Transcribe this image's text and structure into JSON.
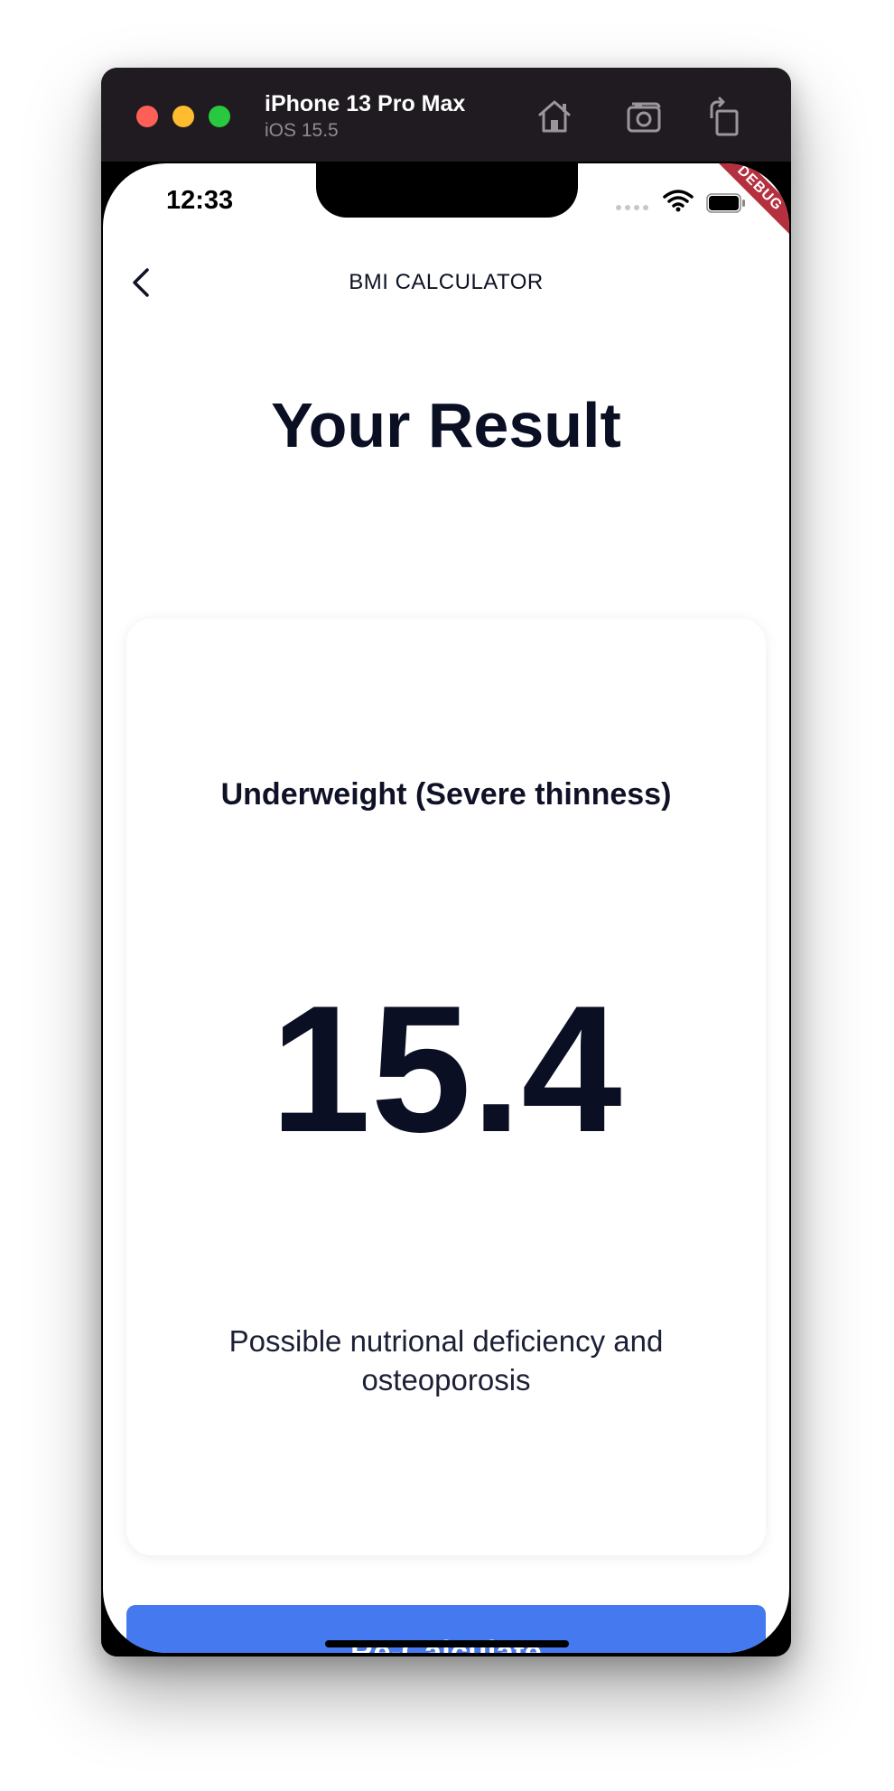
{
  "simulator": {
    "device_name": "iPhone 13 Pro Max",
    "os_version": "iOS 15.5",
    "icons": [
      "home-icon",
      "camera-icon",
      "rotate-icon"
    ]
  },
  "status_bar": {
    "time": "12:33",
    "icons": [
      "wifi-icon",
      "battery-icon"
    ]
  },
  "debug_banner": "DEBUG",
  "nav": {
    "back_icon": "chevron-left-icon",
    "title": "BMI CALCULATOR"
  },
  "page": {
    "title": "Your Result"
  },
  "result": {
    "category": "Underweight (Severe thinness)",
    "bmi": "15.4",
    "advice": "Possible nutrional deficiency and osteoporosis"
  },
  "actions": {
    "recalculate_label": "Re-Calculate"
  },
  "colors": {
    "primary_button": "#4479f0",
    "text_dark": "#0b0f24",
    "debug_ribbon": "#b5303f"
  }
}
